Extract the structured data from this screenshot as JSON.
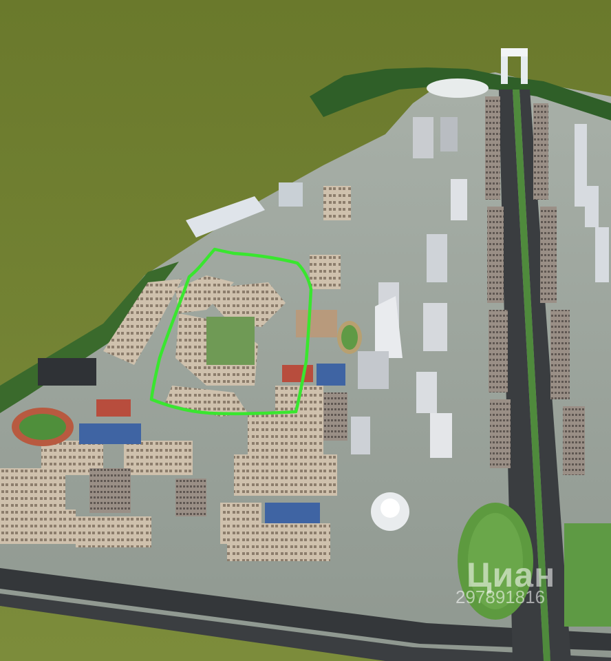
{
  "image": {
    "kind": "aerial-3d-render",
    "colors": {
      "sky_field": "#6c7b2f",
      "field_light": "#7a8a3a",
      "ground": "#9aa59a",
      "road": "#3a3d40",
      "building": "#c9b8a4",
      "building_shadow": "#8f7f6f",
      "tree": "#2f6a2a",
      "highlight": "#39e62f",
      "sport_court": "#3f64a3",
      "sport_red": "#b84d3d"
    }
  },
  "watermark": {
    "logo": "Циан",
    "number": "297891816"
  },
  "highlight": {
    "shape": "freehand-outline",
    "color": "#39e62f"
  }
}
